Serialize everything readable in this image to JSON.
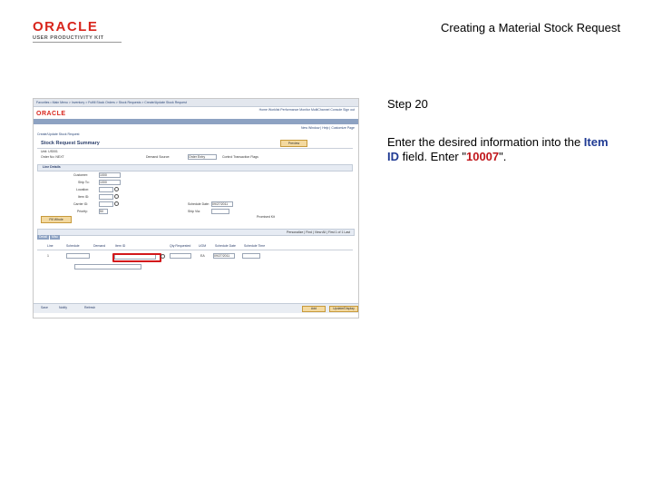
{
  "logo": {
    "brand": "ORACLE",
    "product": "USER PRODUCTIVITY KIT"
  },
  "doc_title": "Creating a Material Stock Request",
  "step": {
    "title": "Step 20",
    "text_prefix": "Enter the desired information into the ",
    "field_name": "Item ID",
    "text_middle": " field. Enter \"",
    "value": "10007",
    "text_suffix": "\"."
  },
  "screenshot": {
    "nav": "Favorites  •  Main Menu  >  Inventory  >  Fulfill Stock Orders  >  Stock Requests  >  Create/Update Stock Request",
    "top_links": "Home    Worklist    Performance Monitor    MultiChannel Console    Sign out",
    "logo": "ORACLE",
    "new_window": "New Window  |  Help  |  Customize Page",
    "breadcrumb": "Create/Update Stock Request",
    "page_title": "Stock Request Summary",
    "preview_label": "Preview",
    "fields": {
      "unit_label": "Unit: US001",
      "order_no_label": "Order No: NEXT",
      "customer_label": "Customer:",
      "customer_value": "1000",
      "ship_to_label": "Ship To:",
      "ship_to_value": "1000",
      "location_label": "Location:",
      "item_id_label": "Item ID:",
      "carrier_label": "Carrier ID:",
      "priority_label": "Priority:",
      "priority_value": "50",
      "demand_source_label": "Demand Source:",
      "demand_source_value": "Order Entry",
      "control_label": "Control Transaction Flags",
      "schedule_date_label": "Schedule Date:",
      "schedule_date_value": "09/27/2011",
      "ship_via_label": "Ship Via:",
      "line_details_label": "Line Details",
      "promised_label": "Promised Kit",
      "fill_label": "Fill Whole"
    },
    "grid": {
      "header": "Personalize  |  Find  |  View All  |  First  1 of 1  Last",
      "tabs": [
        "Detail",
        "Misc"
      ],
      "columns": [
        "Line",
        "Schedule",
        "Demand",
        "Item ID",
        "Qty Requested",
        "UOM",
        "Schedule Date",
        "Schedule Time"
      ],
      "row_line": "1",
      "row_uom": "EA",
      "row_date": "09/27/2011"
    },
    "bottom_left": [
      "Save",
      "Notify",
      "Refresh"
    ],
    "bottom_right": [
      "Add",
      "Update/Display"
    ]
  }
}
